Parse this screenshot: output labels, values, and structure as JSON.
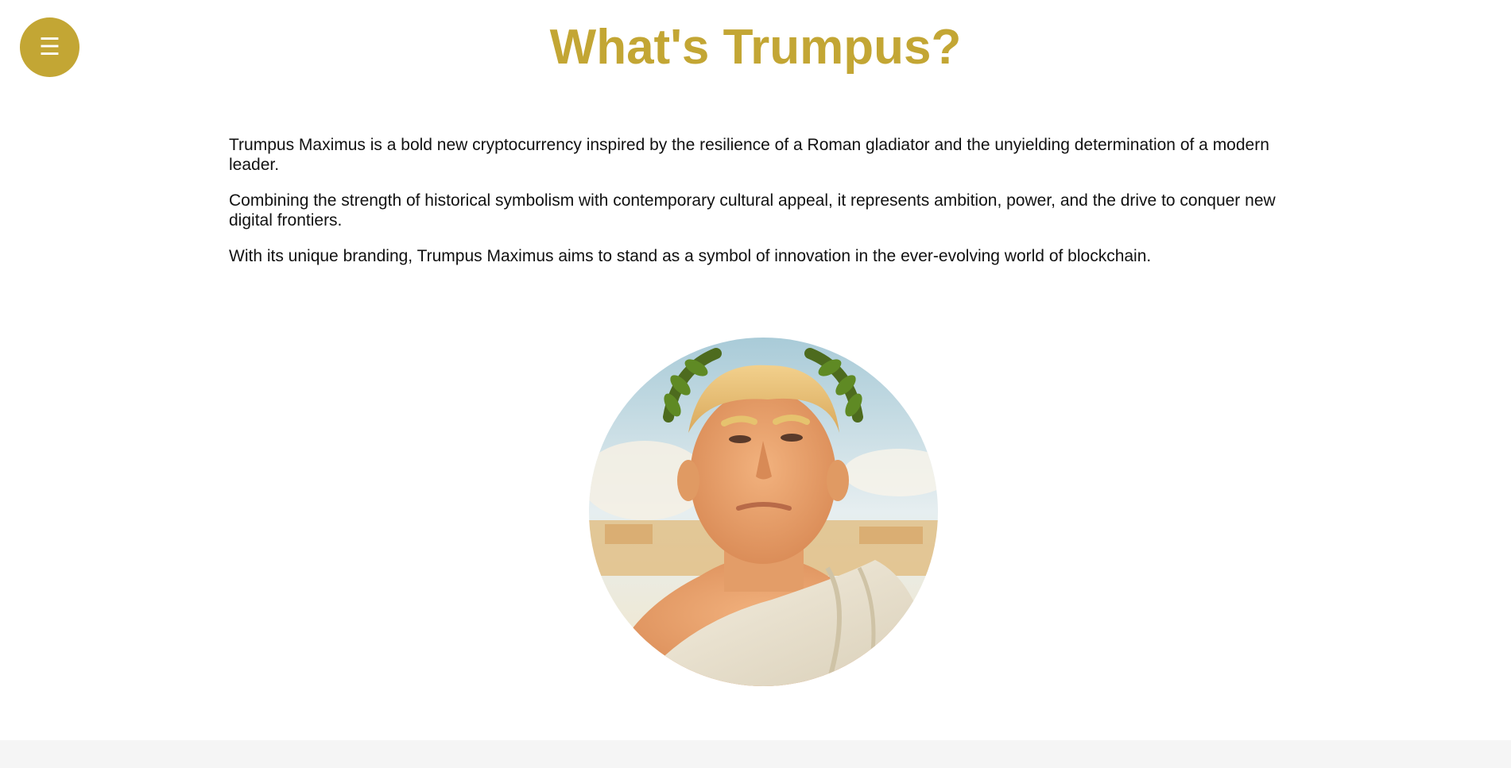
{
  "header": {
    "menu_icon": "☰",
    "title": "What's Trumpus?"
  },
  "intro": {
    "paragraphs": [
      "Trumpus Maximus is a bold new cryptocurrency inspired by the resilience of a Roman gladiator and the unyielding determination of a modern leader.",
      "Combining the strength of historical symbolism with contemporary cultural appeal, it represents ambition, power, and the drive to conquer new digital frontiers.",
      "With its unique branding, Trumpus Maximus aims to stand as a symbol of innovation in the ever-evolving world of blockchain."
    ]
  },
  "colors": {
    "accent": "#c3a634",
    "footer": "#f5f5f5"
  }
}
